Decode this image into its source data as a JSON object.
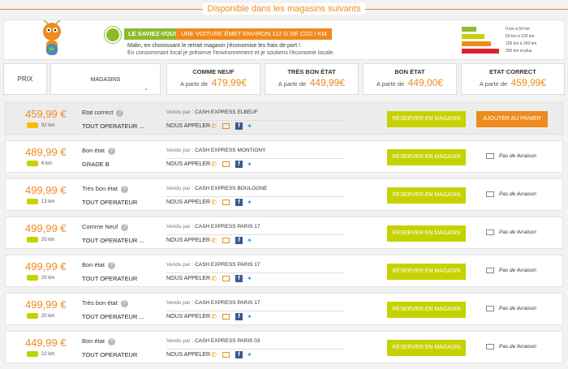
{
  "page": {
    "section_title": "Disponible dans les magasins suivants"
  },
  "banner": {
    "tag1": "LE SAVIEZ-VOUS",
    "tag2": "UNE VOITURE ÉMET ENVIRON 112 G DE CO2 / KM",
    "line1": "Malin, en choisissant le retrait magasin j'économise les frais de port !",
    "line2": "En consommant local je préserve l'environnement et je soutiens l'économie locale.",
    "energy_labels": [
      "0 km à 50 km",
      "50 km à 100 km",
      "100 km à 200 km",
      "200 km et plus"
    ],
    "energy_colors": [
      "#8dbb2b",
      "#c5d200",
      "#f08a1c",
      "#d9262c"
    ]
  },
  "header": {
    "price_label": "PRIX",
    "stores_label": "MAGASINS",
    "conditions": [
      {
        "label": "COMME NEUF",
        "from": "A partir de",
        "price": "479,99€"
      },
      {
        "label": "TRÈS BON ÉTAT",
        "from": "A partir de",
        "price": "449,99€"
      },
      {
        "label": "BON ÉTAT",
        "from": "A partir de",
        "price": "449,00€"
      },
      {
        "label": "ETAT CORRECT",
        "from": "A partir de",
        "price": "459,99€"
      }
    ]
  },
  "common": {
    "sold_by": "Vendu par :",
    "call_us": "NOUS APPELER",
    "reserve_btn": "RÉSERVER EN MAGASIN",
    "add_cart_btn": "AJOUTER AU PANIER",
    "no_delivery": "Pas de livraison"
  },
  "offers": [
    {
      "price": "459,99 €",
      "distance": "92 km",
      "condition": "Etat correct",
      "operator": "TOUT OPERATEUR ...",
      "store": "CASH EXPRESS ELBEUF",
      "bike_color": "#f2c100"
    },
    {
      "price": "489,99 €",
      "distance": "6 km",
      "condition": "Bon état",
      "operator": "GRADE B",
      "store": "CASH EXPRESS MONTIGNY",
      "bike_color": "#c5d200"
    },
    {
      "price": "499,99 €",
      "distance": "13 km",
      "condition": "Très bon état",
      "operator": "TOUT OPERATEUR",
      "store": "CASH EXPRESS BOULOGNE",
      "bike_color": "#c5d200"
    },
    {
      "price": "499,99 €",
      "distance": "20 km",
      "condition": "Comme Neuf",
      "operator": "TOUT OPERATEUR ...",
      "store": "CASH EXPRESS PARIS 17",
      "bike_color": "#c5d200"
    },
    {
      "price": "499,99 €",
      "distance": "20 km",
      "condition": "Bon état",
      "operator": "TOUT OPERATEUR",
      "store": "CASH EXPRESS PARIS 17",
      "bike_color": "#c5d200"
    },
    {
      "price": "499,99 €",
      "distance": "20 km",
      "condition": "Très bon état",
      "operator": "TOUT OPERATEUR ...",
      "store": "CASH EXPRESS PARIS 17",
      "bike_color": "#c5d200"
    },
    {
      "price": "449,99 €",
      "distance": "22 km",
      "condition": "Bon état",
      "operator": "TOUT OPERATEUR",
      "store": "CASH EXPRESS PARIS 03",
      "bike_color": "#c5d200"
    }
  ]
}
